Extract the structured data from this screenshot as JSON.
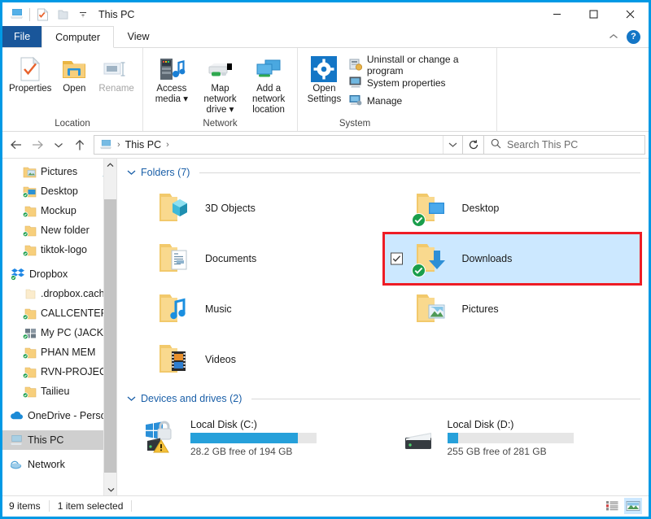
{
  "window": {
    "title": "This PC",
    "quick_access": [
      "properties-icon",
      "new-folder-icon",
      "customize-icon"
    ],
    "controls": {
      "minimize": "minimize-icon",
      "maximize": "maximize-icon",
      "close": "close-icon"
    }
  },
  "ribbon": {
    "tabs": [
      {
        "label": "File",
        "type": "file"
      },
      {
        "label": "Computer",
        "type": "active"
      },
      {
        "label": "View",
        "type": "normal"
      }
    ],
    "collapse_icon": "chevron-up-icon",
    "help_label": "?",
    "groups": [
      {
        "label": "Location",
        "buttons": [
          {
            "label": "Properties",
            "icon": "properties-icon",
            "disabled": false,
            "dropdown": false
          },
          {
            "label": "Open",
            "icon": "open-folder-icon",
            "disabled": false,
            "dropdown": false
          },
          {
            "label": "Rename",
            "icon": "rename-icon",
            "disabled": true,
            "dropdown": false
          }
        ]
      },
      {
        "label": "Network",
        "buttons": [
          {
            "label": "Access media",
            "icon": "access-media-icon",
            "disabled": false,
            "dropdown": true
          },
          {
            "label": "Map network drive",
            "icon": "map-network-drive-icon",
            "disabled": false,
            "dropdown": true
          },
          {
            "label": "Add a network location",
            "icon": "add-network-location-icon",
            "disabled": false,
            "dropdown": false
          }
        ]
      },
      {
        "label": "System",
        "big_button": {
          "label": "Open Settings",
          "icon": "settings-gear-icon"
        },
        "small_buttons": [
          {
            "label": "Uninstall or change a program",
            "icon": "uninstall-program-icon"
          },
          {
            "label": "System properties",
            "icon": "system-properties-icon"
          },
          {
            "label": "Manage",
            "icon": "manage-computer-icon"
          }
        ]
      }
    ]
  },
  "addressbar": {
    "back_icon": "arrow-left-icon",
    "forward_icon": "arrow-right-icon",
    "recent_icon": "chevron-down-icon",
    "up_icon": "arrow-up-icon",
    "path_icon": "this-pc-icon",
    "crumbs": [
      "This PC"
    ],
    "dropdown_icon": "chevron-down-icon",
    "refresh_icon": "refresh-icon",
    "search_icon": "search-icon",
    "search_placeholder": "Search This PC"
  },
  "sidebar": {
    "items": [
      {
        "label": "Pictures",
        "icon": "folder-pictures-icon",
        "indent": 1,
        "pinned": true,
        "synced": false,
        "selected": false
      },
      {
        "label": "Desktop",
        "icon": "folder-desktop-icon",
        "indent": 1,
        "pinned": false,
        "synced": true,
        "selected": false
      },
      {
        "label": "Mockup",
        "icon": "folder-icon",
        "indent": 1,
        "pinned": false,
        "synced": true,
        "selected": false
      },
      {
        "label": "New folder",
        "icon": "folder-icon",
        "indent": 1,
        "pinned": false,
        "synced": true,
        "selected": false
      },
      {
        "label": "tiktok-logo",
        "icon": "folder-icon",
        "indent": 1,
        "pinned": false,
        "synced": true,
        "selected": false
      },
      {
        "label": "Dropbox",
        "icon": "dropbox-icon",
        "indent": 0,
        "pinned": false,
        "synced": true,
        "selected": false
      },
      {
        "label": ".dropbox.cache",
        "icon": "folder-plain-icon",
        "indent": 1,
        "pinned": false,
        "synced": false,
        "selected": false
      },
      {
        "label": "CALLCENTER",
        "icon": "folder-icon",
        "indent": 1,
        "pinned": false,
        "synced": true,
        "selected": false
      },
      {
        "label": "My PC (JACK)",
        "icon": "computer-icon",
        "indent": 1,
        "pinned": false,
        "synced": true,
        "selected": false
      },
      {
        "label": "PHAN MEM",
        "icon": "folder-icon",
        "indent": 1,
        "pinned": false,
        "synced": true,
        "selected": false
      },
      {
        "label": "RVN-PROJECT",
        "icon": "folder-icon",
        "indent": 1,
        "pinned": false,
        "synced": true,
        "selected": false
      },
      {
        "label": "Tailieu",
        "icon": "folder-icon",
        "indent": 1,
        "pinned": false,
        "synced": true,
        "selected": false
      },
      {
        "label": "OneDrive - Person",
        "icon": "onedrive-icon",
        "indent": 0,
        "pinned": false,
        "synced": false,
        "selected": false
      },
      {
        "label": "This PC",
        "icon": "this-pc-icon",
        "indent": 0,
        "pinned": false,
        "synced": false,
        "selected": true
      },
      {
        "label": "Network",
        "icon": "network-icon",
        "indent": 0,
        "pinned": false,
        "synced": false,
        "selected": false
      }
    ],
    "scroll_up_icon": "chevron-up-icon",
    "scroll_down_icon": "chevron-down-icon"
  },
  "main": {
    "folders_group": {
      "label": "Folders (7)",
      "collapse_icon": "chevron-down-icon",
      "items": [
        {
          "label": "3D Objects",
          "icon": "folder-3dobjects-icon",
          "synced": false,
          "selected": false,
          "annotated": false,
          "checked": false
        },
        {
          "label": "Desktop",
          "icon": "folder-desktop-icon",
          "synced": true,
          "selected": false,
          "annotated": false,
          "checked": false
        },
        {
          "label": "Documents",
          "icon": "folder-documents-icon",
          "synced": false,
          "selected": false,
          "annotated": false,
          "checked": false
        },
        {
          "label": "Downloads",
          "icon": "folder-downloads-icon",
          "synced": true,
          "selected": true,
          "annotated": true,
          "checked": true
        },
        {
          "label": "Music",
          "icon": "folder-music-icon",
          "synced": false,
          "selected": false,
          "annotated": false,
          "checked": false
        },
        {
          "label": "Pictures",
          "icon": "folder-pictures-icon",
          "synced": false,
          "selected": false,
          "annotated": false,
          "checked": false
        },
        {
          "label": "Videos",
          "icon": "folder-videos-icon",
          "synced": false,
          "selected": false,
          "annotated": false,
          "checked": false
        }
      ]
    },
    "drives_group": {
      "label": "Devices and drives (2)",
      "collapse_icon": "chevron-down-icon",
      "items": [
        {
          "label": "Local Disk (C:)",
          "icon": "drive-windows-locked-icon",
          "free_text": "28.2 GB free of 194 GB",
          "used_percent": 85,
          "low_space": true
        },
        {
          "label": "Local Disk (D:)",
          "icon": "drive-icon",
          "free_text": "255 GB free of 281 GB",
          "used_percent": 9,
          "low_space": false
        }
      ]
    }
  },
  "statusbar": {
    "item_count": "9 items",
    "selection": "1 item selected",
    "view_buttons": [
      {
        "icon": "details-view-icon",
        "active": false
      },
      {
        "icon": "large-icons-view-icon",
        "active": true
      }
    ]
  },
  "colors": {
    "window_border": "#0099e5",
    "file_tab": "#19569a",
    "accent_blue": "#26a0da",
    "selection": "#cce8ff",
    "annotation_red": "#ee1c25",
    "sync_green": "#1a9e4b",
    "folder_yellow": "#f7cf7c",
    "group_header": "#1a5fa8"
  }
}
